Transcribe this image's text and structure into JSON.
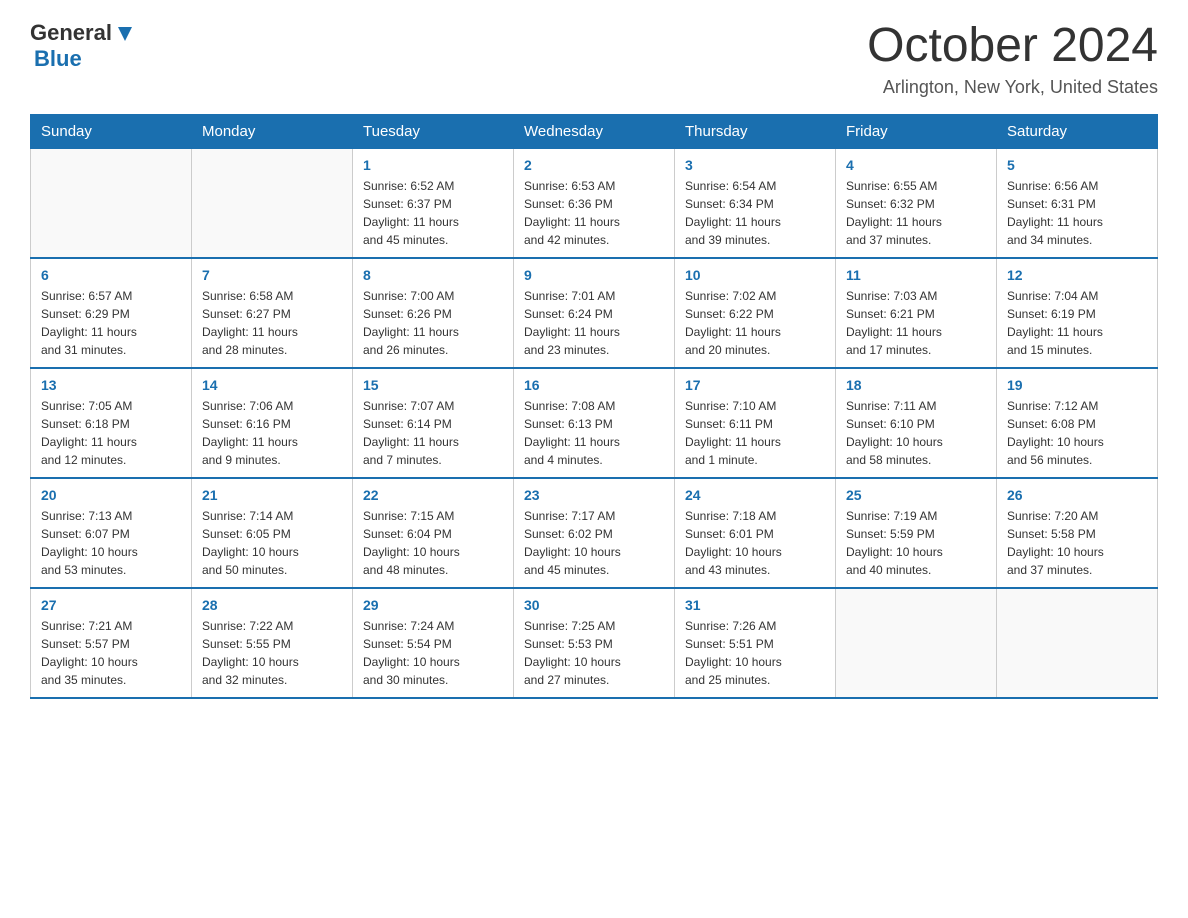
{
  "header": {
    "logo_general": "General",
    "logo_blue": "Blue",
    "title": "October 2024",
    "location": "Arlington, New York, United States"
  },
  "days_of_week": [
    "Sunday",
    "Monday",
    "Tuesday",
    "Wednesday",
    "Thursday",
    "Friday",
    "Saturday"
  ],
  "weeks": [
    [
      {
        "day": "",
        "info": ""
      },
      {
        "day": "",
        "info": ""
      },
      {
        "day": "1",
        "info": "Sunrise: 6:52 AM\nSunset: 6:37 PM\nDaylight: 11 hours\nand 45 minutes."
      },
      {
        "day": "2",
        "info": "Sunrise: 6:53 AM\nSunset: 6:36 PM\nDaylight: 11 hours\nand 42 minutes."
      },
      {
        "day": "3",
        "info": "Sunrise: 6:54 AM\nSunset: 6:34 PM\nDaylight: 11 hours\nand 39 minutes."
      },
      {
        "day": "4",
        "info": "Sunrise: 6:55 AM\nSunset: 6:32 PM\nDaylight: 11 hours\nand 37 minutes."
      },
      {
        "day": "5",
        "info": "Sunrise: 6:56 AM\nSunset: 6:31 PM\nDaylight: 11 hours\nand 34 minutes."
      }
    ],
    [
      {
        "day": "6",
        "info": "Sunrise: 6:57 AM\nSunset: 6:29 PM\nDaylight: 11 hours\nand 31 minutes."
      },
      {
        "day": "7",
        "info": "Sunrise: 6:58 AM\nSunset: 6:27 PM\nDaylight: 11 hours\nand 28 minutes."
      },
      {
        "day": "8",
        "info": "Sunrise: 7:00 AM\nSunset: 6:26 PM\nDaylight: 11 hours\nand 26 minutes."
      },
      {
        "day": "9",
        "info": "Sunrise: 7:01 AM\nSunset: 6:24 PM\nDaylight: 11 hours\nand 23 minutes."
      },
      {
        "day": "10",
        "info": "Sunrise: 7:02 AM\nSunset: 6:22 PM\nDaylight: 11 hours\nand 20 minutes."
      },
      {
        "day": "11",
        "info": "Sunrise: 7:03 AM\nSunset: 6:21 PM\nDaylight: 11 hours\nand 17 minutes."
      },
      {
        "day": "12",
        "info": "Sunrise: 7:04 AM\nSunset: 6:19 PM\nDaylight: 11 hours\nand 15 minutes."
      }
    ],
    [
      {
        "day": "13",
        "info": "Sunrise: 7:05 AM\nSunset: 6:18 PM\nDaylight: 11 hours\nand 12 minutes."
      },
      {
        "day": "14",
        "info": "Sunrise: 7:06 AM\nSunset: 6:16 PM\nDaylight: 11 hours\nand 9 minutes."
      },
      {
        "day": "15",
        "info": "Sunrise: 7:07 AM\nSunset: 6:14 PM\nDaylight: 11 hours\nand 7 minutes."
      },
      {
        "day": "16",
        "info": "Sunrise: 7:08 AM\nSunset: 6:13 PM\nDaylight: 11 hours\nand 4 minutes."
      },
      {
        "day": "17",
        "info": "Sunrise: 7:10 AM\nSunset: 6:11 PM\nDaylight: 11 hours\nand 1 minute."
      },
      {
        "day": "18",
        "info": "Sunrise: 7:11 AM\nSunset: 6:10 PM\nDaylight: 10 hours\nand 58 minutes."
      },
      {
        "day": "19",
        "info": "Sunrise: 7:12 AM\nSunset: 6:08 PM\nDaylight: 10 hours\nand 56 minutes."
      }
    ],
    [
      {
        "day": "20",
        "info": "Sunrise: 7:13 AM\nSunset: 6:07 PM\nDaylight: 10 hours\nand 53 minutes."
      },
      {
        "day": "21",
        "info": "Sunrise: 7:14 AM\nSunset: 6:05 PM\nDaylight: 10 hours\nand 50 minutes."
      },
      {
        "day": "22",
        "info": "Sunrise: 7:15 AM\nSunset: 6:04 PM\nDaylight: 10 hours\nand 48 minutes."
      },
      {
        "day": "23",
        "info": "Sunrise: 7:17 AM\nSunset: 6:02 PM\nDaylight: 10 hours\nand 45 minutes."
      },
      {
        "day": "24",
        "info": "Sunrise: 7:18 AM\nSunset: 6:01 PM\nDaylight: 10 hours\nand 43 minutes."
      },
      {
        "day": "25",
        "info": "Sunrise: 7:19 AM\nSunset: 5:59 PM\nDaylight: 10 hours\nand 40 minutes."
      },
      {
        "day": "26",
        "info": "Sunrise: 7:20 AM\nSunset: 5:58 PM\nDaylight: 10 hours\nand 37 minutes."
      }
    ],
    [
      {
        "day": "27",
        "info": "Sunrise: 7:21 AM\nSunset: 5:57 PM\nDaylight: 10 hours\nand 35 minutes."
      },
      {
        "day": "28",
        "info": "Sunrise: 7:22 AM\nSunset: 5:55 PM\nDaylight: 10 hours\nand 32 minutes."
      },
      {
        "day": "29",
        "info": "Sunrise: 7:24 AM\nSunset: 5:54 PM\nDaylight: 10 hours\nand 30 minutes."
      },
      {
        "day": "30",
        "info": "Sunrise: 7:25 AM\nSunset: 5:53 PM\nDaylight: 10 hours\nand 27 minutes."
      },
      {
        "day": "31",
        "info": "Sunrise: 7:26 AM\nSunset: 5:51 PM\nDaylight: 10 hours\nand 25 minutes."
      },
      {
        "day": "",
        "info": ""
      },
      {
        "day": "",
        "info": ""
      }
    ]
  ]
}
